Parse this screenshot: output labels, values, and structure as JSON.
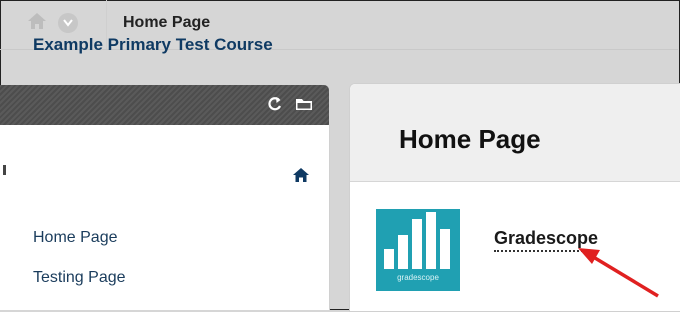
{
  "topbar": {
    "breadcrumb": "Home Page"
  },
  "sidebar": {
    "course_title": "Example Primary Test Course",
    "items": [
      {
        "label": "Home Page"
      },
      {
        "label": "Testing Page"
      }
    ]
  },
  "main": {
    "title": "Home Page",
    "tool": {
      "label": "Gradescope",
      "logo_text": "gradescope"
    }
  },
  "colors": {
    "accent_teal": "#20a0b2",
    "nav_blue": "#0f3a63",
    "arrow_red": "#e02020"
  }
}
